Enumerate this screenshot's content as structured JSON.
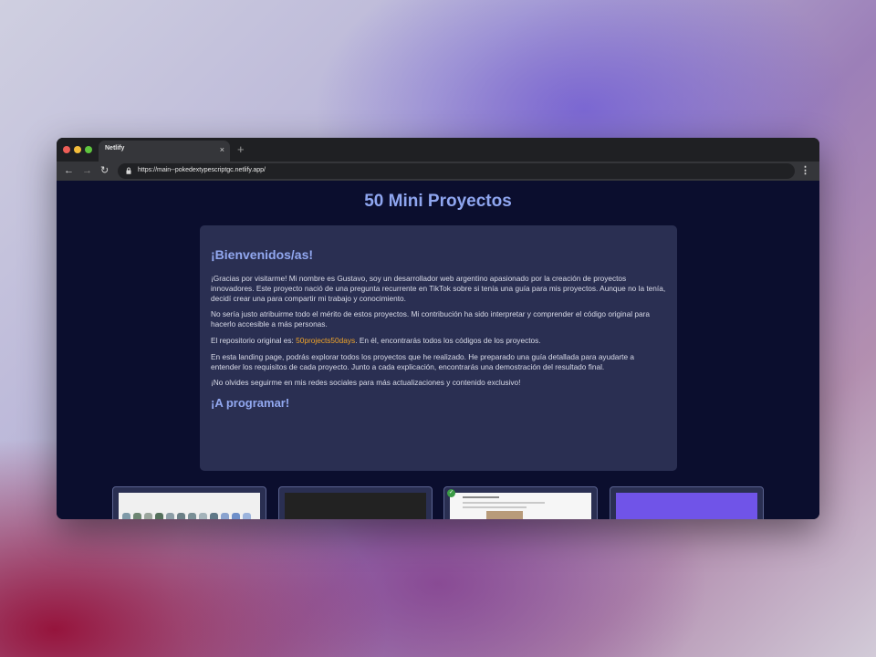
{
  "browser": {
    "tab_title": "Netlify",
    "tab_close_glyph": "×",
    "new_tab_glyph": "+",
    "url": "https://main--pokedextypescriptgc.netlify.app/",
    "nav": {
      "back_glyph": "←",
      "forward_glyph": "→",
      "reload_glyph": "↻",
      "menu_glyph": "⋮"
    }
  },
  "page": {
    "title": "50 Mini Proyectos",
    "welcome_heading": "¡Bienvenidos/as!",
    "paragraph1": "¡Gracias por visitarme! Mi nombre es Gustavo, soy un desarrollador web argentino apasionado por la creación de proyectos innovadores. Este proyecto nació de una pregunta recurrente en TikTok sobre si tenía una guía para mis proyectos. Aunque no la tenía, decidí crear una para compartir mi trabajo y conocimiento.",
    "paragraph2": "No sería justo atribuirme todo el mérito de estos proyectos. Mi contribución ha sido interpretar y comprender el código original para hacerlo accesible a más personas.",
    "repo_prefix": "El repositorio original es: ",
    "repo_link": "50projects50days",
    "repo_suffix": ". En él, encontrarás todos los códigos de los proyectos.",
    "paragraph4": "En esta landing page, podrás explorar todos los proyectos que he realizado. He preparado una guía detallada para ayudarte a entender los requisitos de cada proyecto. Junto a cada explicación, encontrarás una demostración del resultado final.",
    "paragraph5": "¡No olvides seguirme en mis redes sociales para más actualizaciones y contenido exclusivo!",
    "closing_heading": "¡A programar!"
  },
  "colors": {
    "page_background": "#0b0e2e",
    "card_background": "#2a2f52",
    "heading_accent": "#8fa6f0",
    "link_accent": "#f0a42a"
  },
  "icons": [
    "close-icon",
    "plus-icon",
    "back-arrow-icon",
    "forward-arrow-icon",
    "reload-icon",
    "lock-icon",
    "kebab-menu-icon",
    "checkmark-icon"
  ]
}
